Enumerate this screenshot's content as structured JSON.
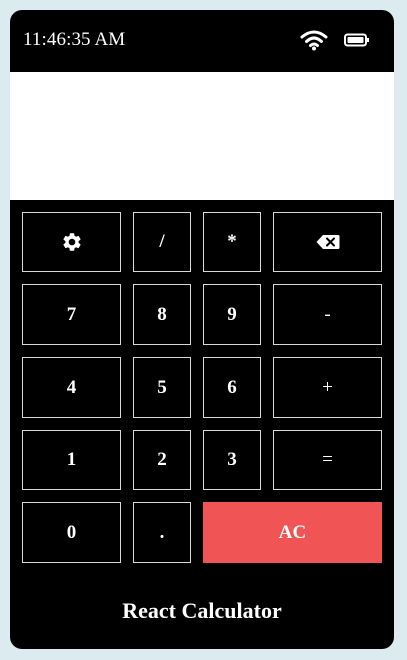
{
  "status_bar": {
    "time": "11:46:35 AM",
    "wifi_icon": "wifi-icon",
    "battery_icon": "battery-icon"
  },
  "display": {
    "value": ""
  },
  "keys": {
    "settings": "gear-icon",
    "divide": "/",
    "multiply": "*",
    "backspace": "backspace-icon",
    "seven": "7",
    "eight": "8",
    "nine": "9",
    "minus": "-",
    "four": "4",
    "five": "5",
    "six": "6",
    "plus": "+",
    "one": "1",
    "two": "2",
    "three": "3",
    "equals": "=",
    "zero": "0",
    "decimal": ".",
    "clear": "AC"
  },
  "colors": {
    "background": "#dcebef",
    "phone": "#000000",
    "display": "#ffffff",
    "clear_button": "#f05454"
  },
  "footer": {
    "title": "React Calculator"
  }
}
